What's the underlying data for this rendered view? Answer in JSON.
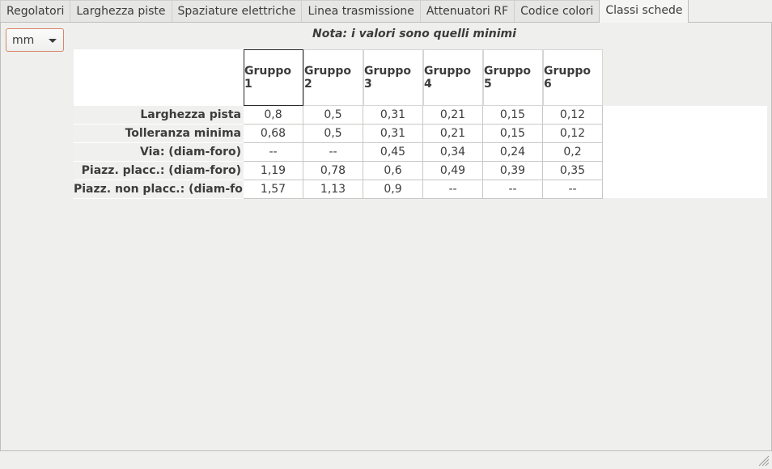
{
  "tabs": [
    {
      "label": "Regolatori",
      "active": false
    },
    {
      "label": "Larghezza piste",
      "active": false
    },
    {
      "label": "Spaziature elettriche",
      "active": false
    },
    {
      "label": "Linea trasmissione",
      "active": false
    },
    {
      "label": "Attenuatori RF",
      "active": false
    },
    {
      "label": "Codice colori",
      "active": false
    },
    {
      "label": "Classi schede",
      "active": true
    }
  ],
  "unit_select": {
    "value": "mm"
  },
  "note": "Nota: i valori sono quelli minimi",
  "table": {
    "columns": [
      "Gruppo 1",
      "Gruppo 2",
      "Gruppo 3",
      "Gruppo 4",
      "Gruppo 5",
      "Gruppo 6"
    ],
    "rows": [
      {
        "label": "Larghezza pista",
        "values": [
          "0,8",
          "0,5",
          "0,31",
          "0,21",
          "0,15",
          "0,12"
        ]
      },
      {
        "label": "Tolleranza minima",
        "values": [
          "0,68",
          "0,5",
          "0,31",
          "0,21",
          "0,15",
          "0,12"
        ]
      },
      {
        "label": "Via: (diam-foro)",
        "values": [
          "--",
          "--",
          "0,45",
          "0,34",
          "0,24",
          "0,2"
        ]
      },
      {
        "label": "Piazz. placc.: (diam-foro)",
        "values": [
          "1,19",
          "0,78",
          "0,6",
          "0,49",
          "0,39",
          "0,35"
        ]
      },
      {
        "label": "Piazz. non placc.: (diam-foro)",
        "values": [
          "1,57",
          "1,13",
          "0,9",
          "--",
          "--",
          "--"
        ]
      }
    ]
  }
}
